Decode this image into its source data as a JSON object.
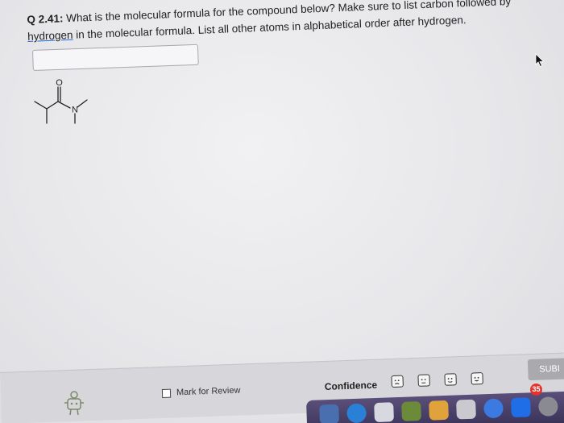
{
  "question": {
    "number": "Q 2.41:",
    "line1": "What is the molecular formula for the compound below? Make sure to list carbon followed by",
    "line2_link": "hydrogen",
    "line2_rest": " in the molecular formula. List all other atoms in alphabetical order after hydrogen."
  },
  "answer": {
    "value": "",
    "placeholder": ""
  },
  "molecule": {
    "oxygen_label": "O",
    "nitrogen_label": "N"
  },
  "footer": {
    "mark_for_review": "Mark for Review",
    "confidence_label": "Confidence",
    "submit_label": "SUBI"
  },
  "dock": {
    "badge_count": "35"
  },
  "colors": {
    "link_underline": "#2d6ed6",
    "submit_bg": "#a9a9ae",
    "dock_bg": "#3a3358",
    "badge": "#e5322d"
  }
}
